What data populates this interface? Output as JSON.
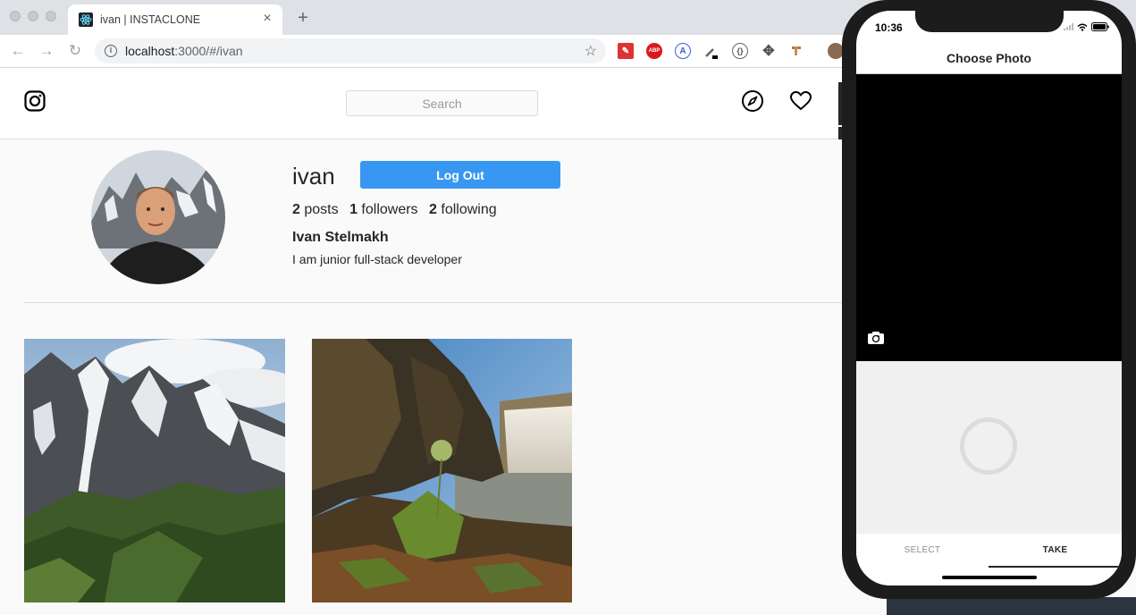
{
  "browser": {
    "tab_title": "ivan | INSTACLONE",
    "new_tab_symbol": "+",
    "close_symbol": "×",
    "url_host": "localhost",
    "url_rest": ":3000/#/ivan",
    "extensions": [
      "clip-icon",
      "abp-icon",
      "a-icon",
      "eyedropper-icon",
      "curly-icon",
      "move-icon",
      "ruler-icon"
    ],
    "abp_label": "ABP"
  },
  "site": {
    "search_placeholder": "Search"
  },
  "profile": {
    "username": "ivan",
    "logout_label": "Log Out",
    "posts_count": "2",
    "posts_label": "posts",
    "followers_count": "1",
    "followers_label": "followers",
    "following_count": "2",
    "following_label": "following",
    "full_name": "Ivan Stelmakh",
    "bio": "I am junior full-stack developer"
  },
  "posts": [
    {
      "subject": "mountain-photo"
    },
    {
      "subject": "waterfall-photo"
    }
  ],
  "phone": {
    "time": "10:36",
    "title": "Choose Photo",
    "tab_select": "SELECT",
    "tab_take": "TAKE",
    "active_tab": "TAKE"
  }
}
